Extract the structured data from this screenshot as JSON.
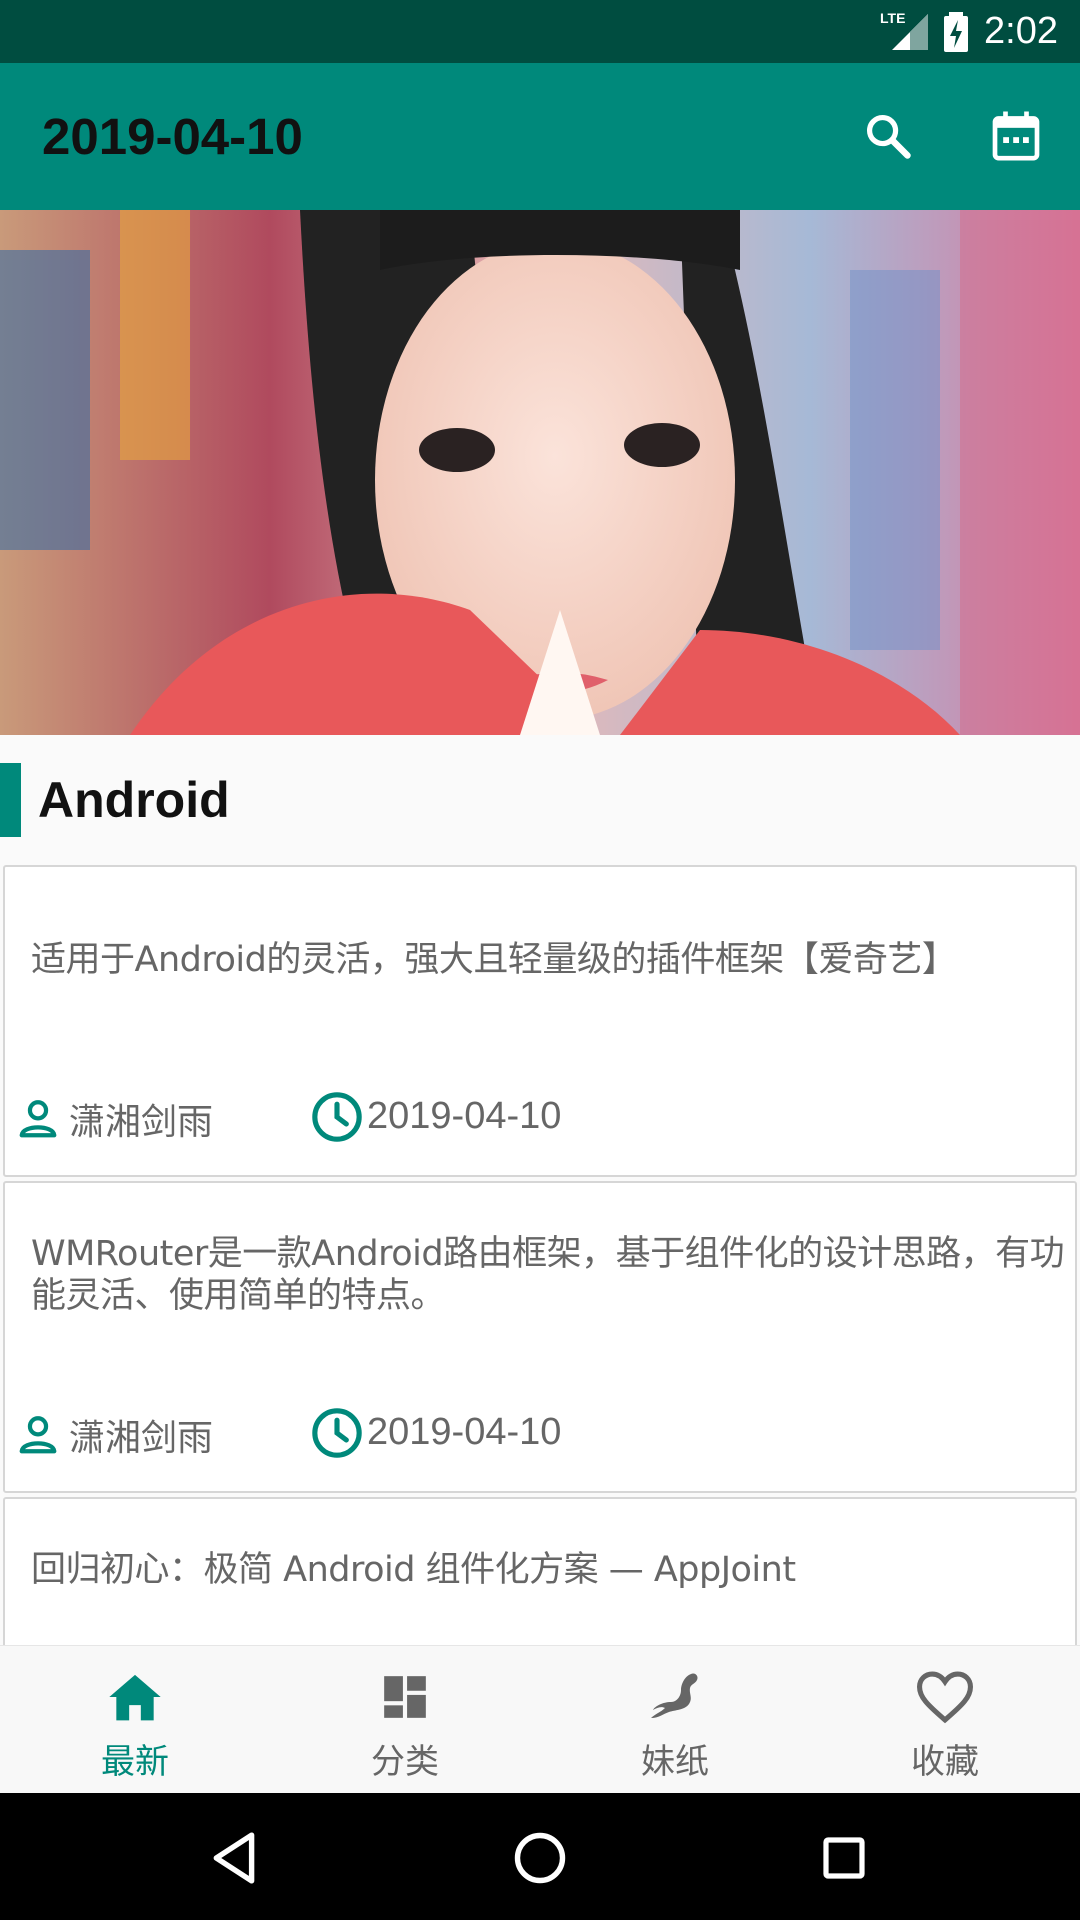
{
  "status_bar": {
    "time": "2:02",
    "network": "LTE",
    "icons": [
      "signal-icon",
      "battery-charging-icon"
    ]
  },
  "app_bar": {
    "title": "2019-04-10",
    "actions": [
      "search-icon",
      "calendar-icon"
    ]
  },
  "hero": {
    "alt": ""
  },
  "section": {
    "title": "Android"
  },
  "cards": [
    {
      "desc": "适用于Android的灵活，强大且轻量级的插件框架【爱奇艺】",
      "author": "潇湘剑雨",
      "date": "2019-04-10"
    },
    {
      "desc": "WMRouter是一款Android路由框架，基于组件化的设计思路，有功能灵活、使用简单的特点。",
      "author": "潇湘剑雨",
      "date": "2019-04-10"
    },
    {
      "desc": "回归初心：极简 Android 组件化方案 — AppJoint",
      "author": "",
      "date": ""
    }
  ],
  "bottom_nav": [
    {
      "label": "最新",
      "icon": "home-icon",
      "active": true
    },
    {
      "label": "分类",
      "icon": "dashboard-icon",
      "active": false
    },
    {
      "label": "妹纸",
      "icon": "figure-icon",
      "active": false
    },
    {
      "label": "收藏",
      "icon": "heart-icon",
      "active": false
    }
  ],
  "colors": {
    "accent": "#00897b",
    "status_bar": "#004d40",
    "text": "#666666"
  }
}
